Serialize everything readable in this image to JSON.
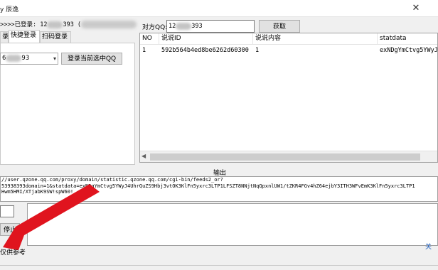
{
  "window": {
    "title": "y 辰逸",
    "close_icon": "close-icon"
  },
  "login": {
    "prefix": ">>>>已登录: 12",
    "suffix": "393 ("
  },
  "tabs": [
    {
      "label": "录",
      "active": false
    },
    {
      "label": "快捷登录",
      "active": true
    },
    {
      "label": "扫码登录",
      "active": false
    }
  ],
  "quick_login": {
    "selected_prefix": "6",
    "selected_suffix": "93",
    "login_button": "登录当前选中QQ"
  },
  "peer": {
    "label": "对方QQ:",
    "value_prefix": "12",
    "value_suffix": "393",
    "fetch_button": "获取"
  },
  "table": {
    "columns": [
      "NO",
      "说说ID",
      "说说内容",
      "statdata"
    ],
    "rows": [
      [
        "1",
        "592b564b4ed8be6262d60300",
        "1",
        "exNDgYmCtvg5YWyJ"
      ]
    ]
  },
  "output": {
    "label": "输出",
    "lines": [
      "//user.qzone.qq.com/proxy/domain/statistic.qzone.qq.com/cgi-bin/feeds2_or?",
      "53938393domain=1&statdata=exNDgYmCtvg5YWyJ4UhrQuZS9Hbj3vtOK3KlFn5yxrc3LTP1LFSZT8NNjtNqQpxnlUW1/tZKR4FGv4hZ64ejbY3ITH3WFvEmK3KlFn5yxrc3LTP1",
      "Hwm5HMI/XTjabK9SW!spW60!"
    ]
  },
  "controls": {
    "stop_button": "停止",
    "disclaimer": "仅供参考",
    "send_button_partial": "关"
  }
}
